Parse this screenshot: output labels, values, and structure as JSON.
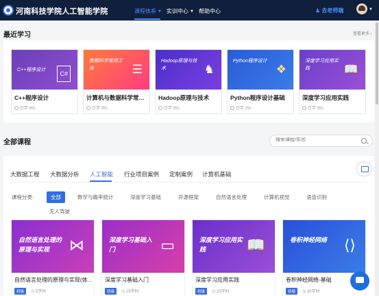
{
  "header": {
    "brand": "河南科技学院人工智能学院",
    "nav": [
      {
        "label": "课程体系",
        "active": true,
        "has_menu": true
      },
      {
        "label": "实训中心",
        "active": false,
        "has_menu": true
      },
      {
        "label": "帮助中心",
        "active": false,
        "has_menu": false
      }
    ],
    "teach_label": "去老师端"
  },
  "recent": {
    "title": "最近学习",
    "more": "查看更多 ›",
    "courses": [
      {
        "name": "C++程序设计",
        "progress": "已学 6%",
        "thumb_text": "C++程序设计",
        "icon": "cpp-icon",
        "color_from": "#6b3fb8",
        "color_to": "#8f4fd1"
      },
      {
        "name": "计算机与数据科学常用...",
        "progress": "已学 0%",
        "thumb_text": "数据科学常用工具",
        "icon": "database-icon",
        "color_from": "#ff6a3d",
        "color_to": "#ff3d7f"
      },
      {
        "name": "Hadoop原理与技术",
        "progress": "已学 5%",
        "thumb_text": "Hadoop原理与技术",
        "icon": "elephant-icon",
        "color_from": "#4a2fc9",
        "color_to": "#7a3fe0"
      },
      {
        "name": "Python程序设计基础",
        "progress": "已学 2%",
        "thumb_text": "Python程序设计",
        "icon": "python-icon",
        "color_from": "#2a5bd8",
        "color_to": "#3a7de8"
      },
      {
        "name": "深度学习应用实践",
        "progress": "已学 5%",
        "thumb_text": "深度学习应用实践",
        "icon": "book-icon",
        "color_from": "#6a3fc9",
        "color_to": "#9a4fd8"
      }
    ]
  },
  "all": {
    "title": "全部课程",
    "search_placeholder": "搜索课程/实验",
    "tabs": [
      {
        "label": "大数据工程",
        "active": false
      },
      {
        "label": "大数据分析",
        "active": false
      },
      {
        "label": "人工智能",
        "active": true
      },
      {
        "label": "行业项目案例",
        "active": false
      },
      {
        "label": "定制案例",
        "active": false
      },
      {
        "label": "计算机基础",
        "active": false
      }
    ],
    "category_label": "课程分类:",
    "categories": [
      {
        "label": "全部",
        "active": true
      },
      {
        "label": "数学与概率统计",
        "active": false
      },
      {
        "label": "深度学习基础",
        "active": false
      },
      {
        "label": "开源框架",
        "active": false
      },
      {
        "label": "自然语言处理",
        "active": false
      },
      {
        "label": "计算机视觉",
        "active": false
      },
      {
        "label": "语音识别",
        "active": false
      },
      {
        "label": "无人驾驶",
        "active": false
      }
    ],
    "courses": [
      {
        "name": "自然语言处理的原理与实现(体...",
        "thumb_text": "自然语言处理的原理与实现",
        "icon": "network-icon",
        "tag": "初级",
        "hours": "5学时",
        "color_from": "#8a2fd0",
        "color_to": "#c93fb8"
      },
      {
        "name": "深度学习基础入门",
        "thumb_text": "深度学习基础入门",
        "icon": "monitor-icon",
        "tag": "初级",
        "hours": "29学时",
        "color_from": "#9a2fc9",
        "color_to": "#d83fa8"
      },
      {
        "name": "深度学习应用实践",
        "thumb_text": "深度学习应用实践",
        "icon": "book-icon",
        "tag": "初级",
        "hours": "33学时",
        "color_from": "#6a2fc9",
        "color_to": "#9a4fd8"
      },
      {
        "name": "卷积神经网络-基础",
        "thumb_text": "卷积神经网络",
        "icon": "code-icon",
        "tag": "初级",
        "hours": "30学时",
        "color_from": "#2a4fd8",
        "color_to": "#3a7de8"
      }
    ]
  }
}
